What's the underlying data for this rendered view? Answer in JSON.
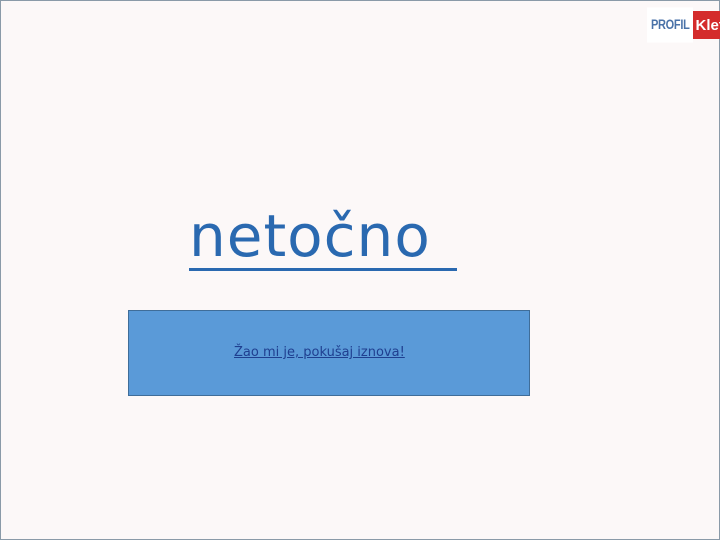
{
  "logo": {
    "left_text": "PROFIL",
    "right_text": "Klett",
    "colors": {
      "left_text": "#4a72a8",
      "right_bg": "#d42b2b"
    }
  },
  "result": {
    "heading": "netočno",
    "color": "#2a69b0"
  },
  "retry": {
    "label": "Žao mi je, pokušaj iznova!",
    "box_color": "#5a9ad8"
  }
}
